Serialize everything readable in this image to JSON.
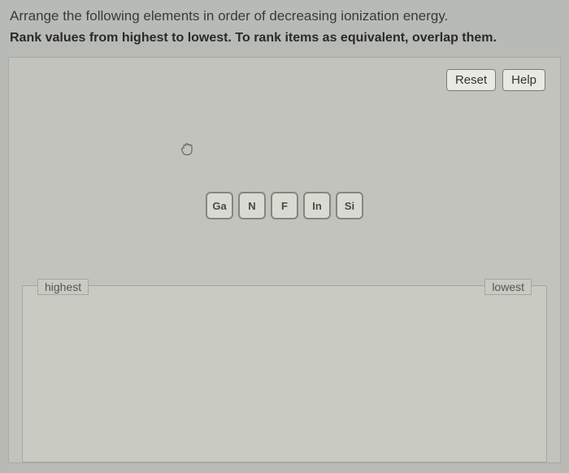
{
  "intro": "Arrange the following elements in order of decreasing ionization energy.",
  "instruction": "Rank values from highest to lowest. To rank items as equivalent, overlap them.",
  "buttons": {
    "reset": "Reset",
    "help": "Help"
  },
  "tiles": {
    "t0": "Ga",
    "t1": "N",
    "t2": "F",
    "t3": "In",
    "t4": "Si"
  },
  "labels": {
    "highest": "highest",
    "lowest": "lowest"
  }
}
